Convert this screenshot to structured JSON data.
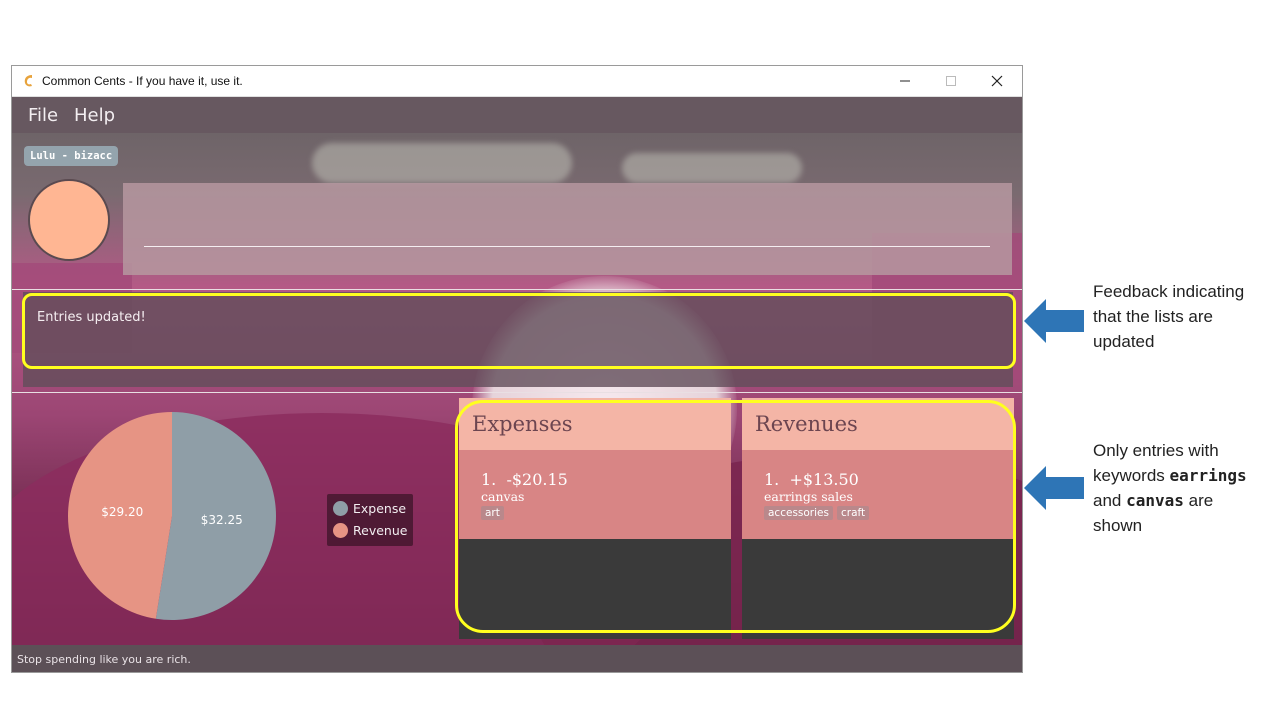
{
  "window": {
    "title": "Common Cents - If you have it, use it.",
    "controls": {
      "minimize": "—",
      "maximize": "☐",
      "close": "✕"
    }
  },
  "menu": [
    "File",
    "Help"
  ],
  "user_badge": "Lulu - bizacc",
  "command_input": {
    "value": "",
    "placeholder": ""
  },
  "result_display": "Entries updated!",
  "pie_chart": {
    "chart_data": {
      "type": "pie",
      "categories": [
        "Expense",
        "Revenue"
      ],
      "values": [
        32.25,
        29.2
      ],
      "value_labels": [
        "$32.25",
        "$29.20"
      ],
      "colors": [
        "#8f9ea7",
        "#e69484"
      ],
      "legend_placement": "right"
    }
  },
  "expenses": {
    "title": "Expenses",
    "entries": [
      {
        "index": "1.",
        "amount": "-$20.15",
        "description": "canvas",
        "tags": [
          "art"
        ]
      }
    ]
  },
  "revenues": {
    "title": "Revenues",
    "entries": [
      {
        "index": "1.",
        "amount": "+$13.50",
        "description": "earrings sales",
        "tags": [
          "accessories",
          "craft"
        ]
      }
    ]
  },
  "status_bar": "Stop spending like you are rich.",
  "annotations": {
    "feedback_note": [
      "Feedback indicating",
      "that the lists are",
      "updated"
    ],
    "filter_note": {
      "line1": "Only entries with",
      "line2_prefix": "keywords",
      "keyword1": "earrings",
      "line3_prefix": "and",
      "keyword2": "canvas",
      "line3_suffix": "are",
      "line4": "shown"
    },
    "highlight_color": "#ffff1f",
    "arrow_color": "#2e75b6"
  }
}
